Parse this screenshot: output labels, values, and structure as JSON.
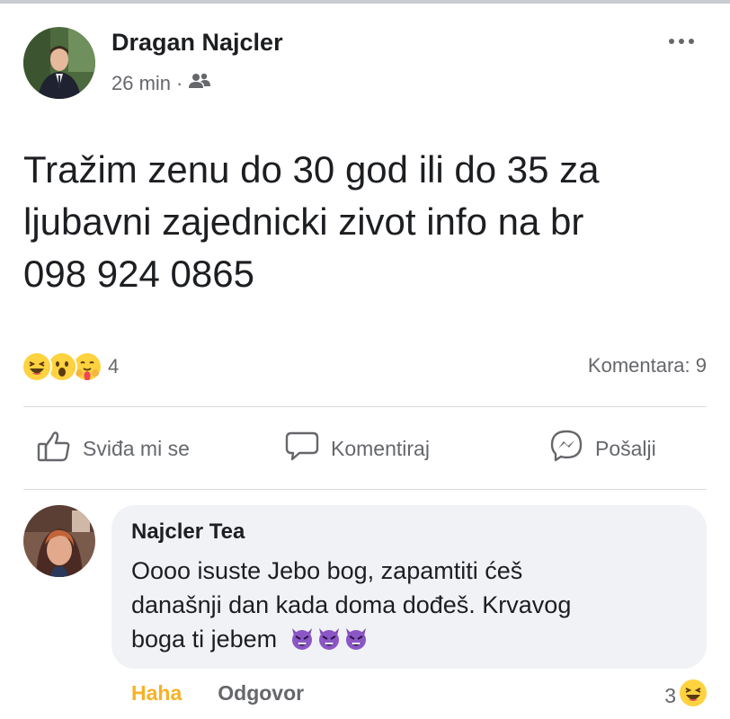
{
  "post": {
    "author": "Dragan Najcler",
    "time": "26 min",
    "separator": "·",
    "audience_icon": "friends-icon",
    "text_line_1": "Tražim zenu do 30 god ili do 35 za",
    "text_line_2": "ljubavni zajednicki zivot info na br",
    "text_line_3": "098 924 0865",
    "reactions": [
      "haha",
      "wow",
      "care"
    ],
    "reaction_count": "4",
    "comments_label": "Komentara: 9"
  },
  "actions": {
    "like": "Sviđa mi se",
    "comment": "Komentiraj",
    "send": "Pošalji"
  },
  "comment": {
    "author": "Najcler Tea",
    "text_line_1": "Oooo isuste Jebo bog, zapamtiti ćeš",
    "text_line_2": "današnji dan kada doma dođeš. Krvavog",
    "text_line_3": "boga ti jebem",
    "emojis": [
      "devil-icon",
      "devil-icon",
      "devil-icon"
    ],
    "reaction_label": "Haha",
    "reply_label": "Odgovor",
    "reaction_count": "3",
    "reaction_icon": "haha-icon"
  },
  "colors": {
    "text": "#1c1e21",
    "muted": "#65676b",
    "bubble": "#f0f2f5",
    "haha": "#f7b125",
    "divider": "#dadde1"
  }
}
